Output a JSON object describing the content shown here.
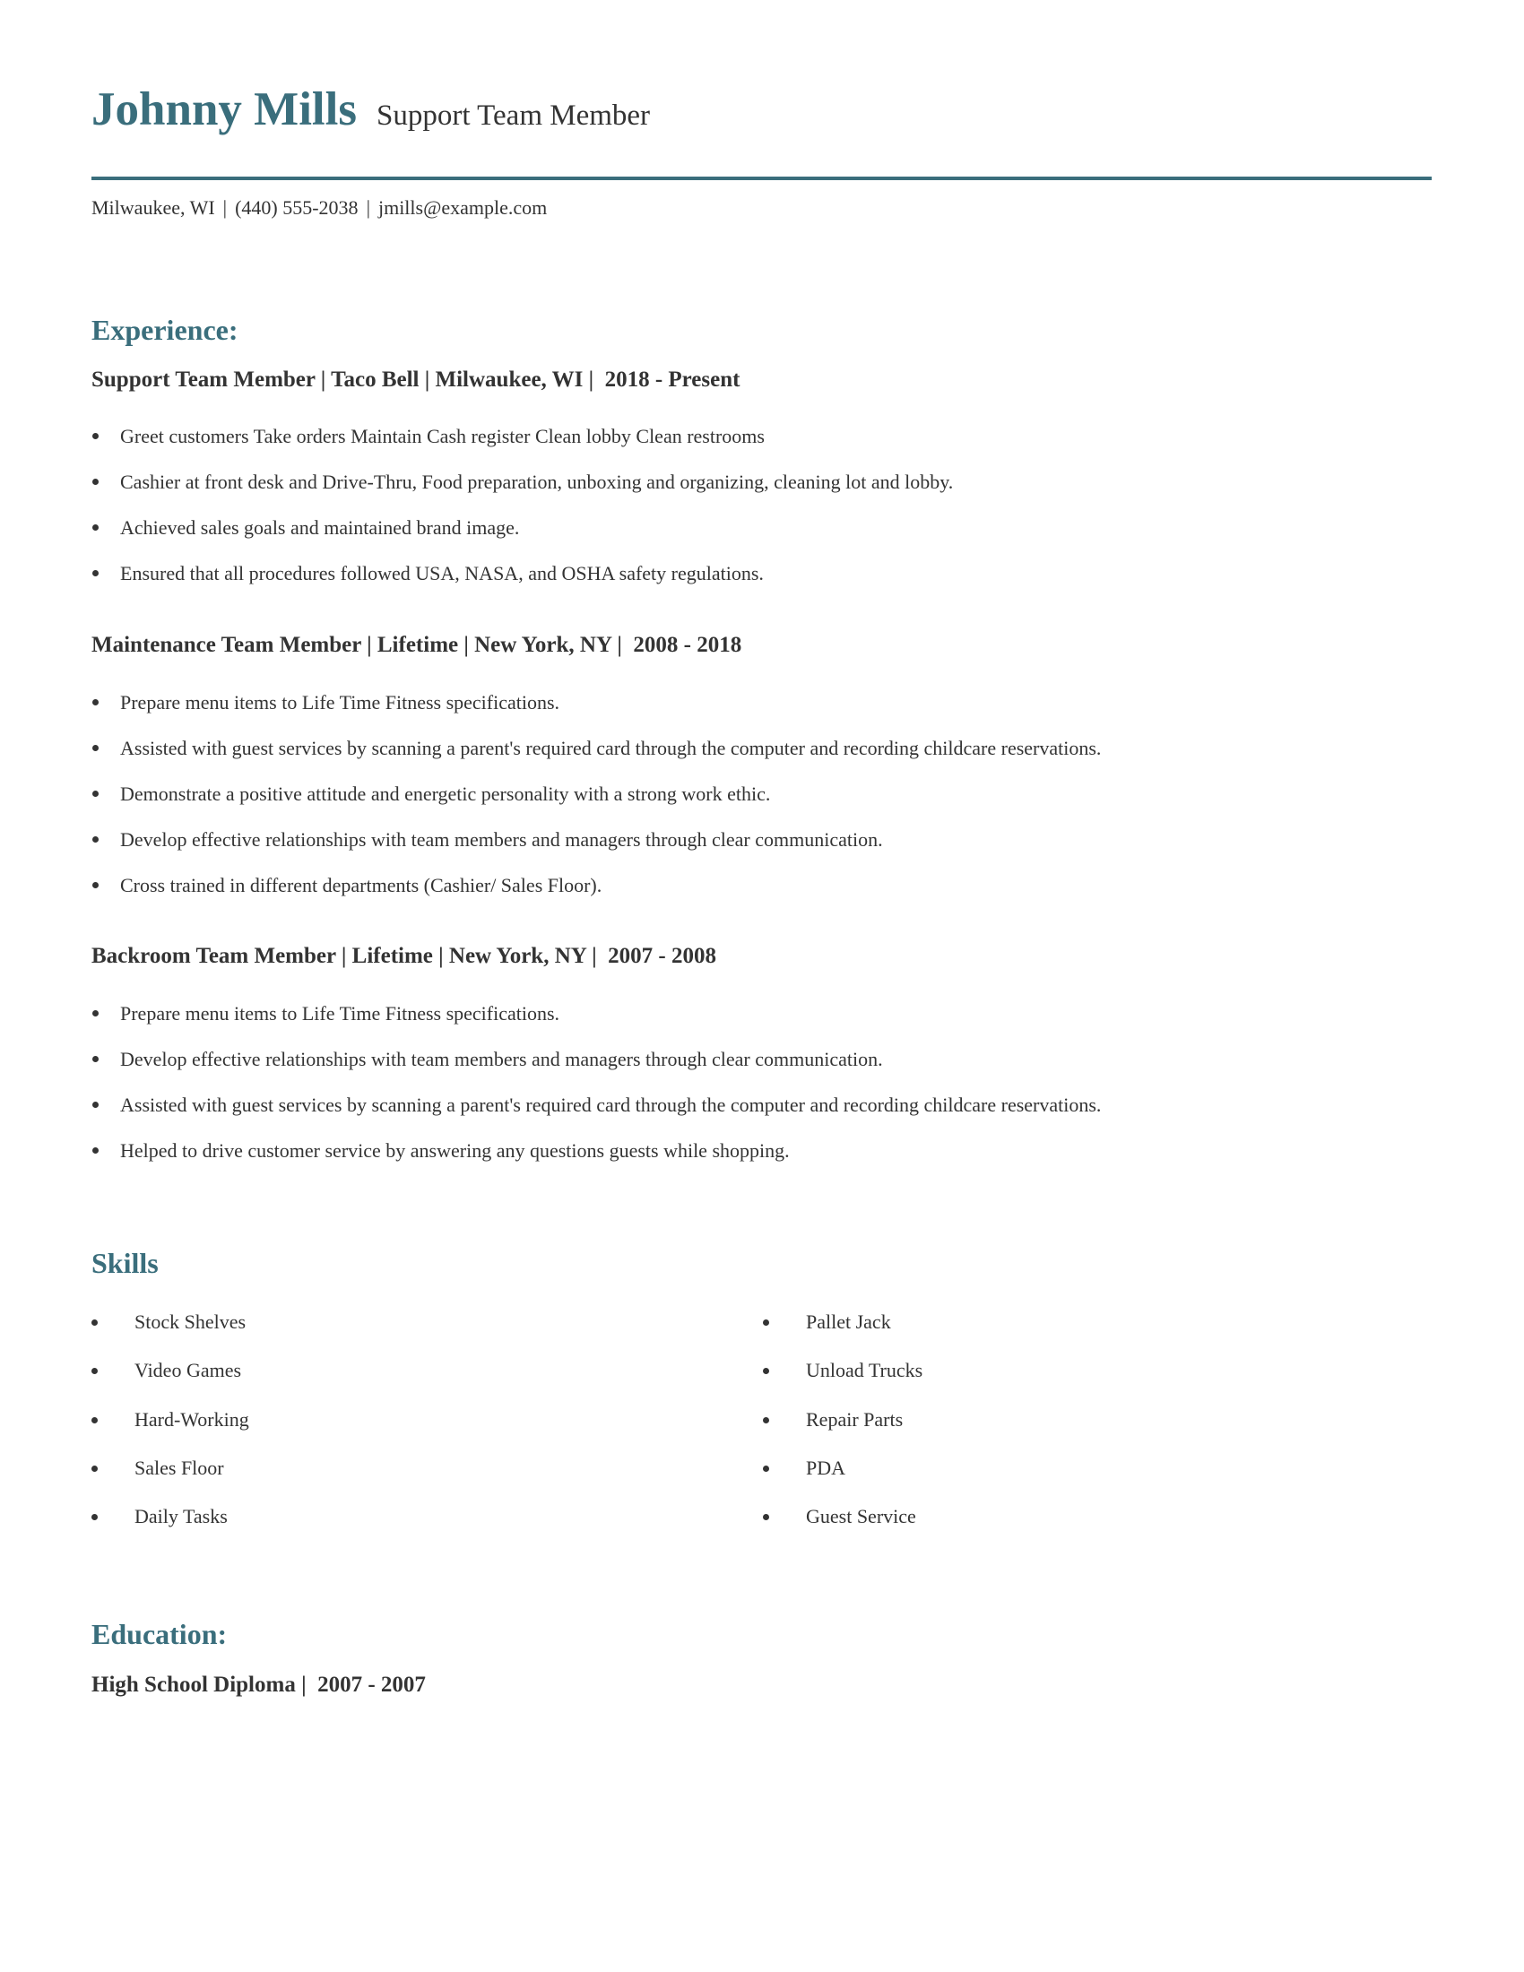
{
  "header": {
    "name": "Johnny Mills",
    "title": "Support Team Member",
    "contact": {
      "location": "Milwaukee, WI",
      "phone": "(440) 555-2038",
      "email": "jmills@example.com",
      "separator": "|"
    },
    "accent_color": "#3a6e7c"
  },
  "experience": {
    "heading": "Experience:",
    "jobs": [
      {
        "title": "Support Team Member | Taco Bell | Milwaukee, WI |  2018 - Present",
        "bullets": [
          "Greet customers Take orders Maintain Cash register Clean lobby Clean restrooms",
          "Cashier at front desk and Drive-Thru, Food preparation, unboxing and organizing, cleaning lot and lobby.",
          "Achieved sales goals and maintained brand image.",
          "Ensured that all procedures followed USA, NASA, and OSHA safety regulations."
        ]
      },
      {
        "title": "Maintenance Team Member | Lifetime | New York, NY |  2008 - 2018",
        "bullets": [
          "Prepare menu items to Life Time Fitness specifications.",
          "Assisted with guest services by scanning a parent's required card through the computer and recording childcare reservations.",
          "Demonstrate a positive attitude and energetic personality with a strong work ethic.",
          "Develop effective relationships with team members and managers through clear communication.",
          "Cross trained in different departments (Cashier/ Sales Floor)."
        ]
      },
      {
        "title": "Backroom Team Member | Lifetime | New York, NY |  2007 - 2008",
        "bullets": [
          "Prepare menu items to Life Time Fitness specifications.",
          "Develop effective relationships with team members and managers through clear communication.",
          "Assisted with guest services by scanning a parent's required card through the computer and recording childcare reservations.",
          "Helped to drive customer service by answering any questions guests while shopping."
        ]
      }
    ]
  },
  "skills": {
    "heading": "Skills",
    "left": [
      "Stock Shelves",
      "Video Games",
      "Hard-Working",
      "Sales Floor",
      "Daily Tasks"
    ],
    "right": [
      "Pallet Jack",
      "Unload Trucks",
      "Repair Parts",
      "PDA",
      "Guest Service"
    ]
  },
  "education": {
    "heading": "Education:",
    "entries": [
      {
        "title": "High School Diploma |  2007 - 2007"
      }
    ]
  }
}
